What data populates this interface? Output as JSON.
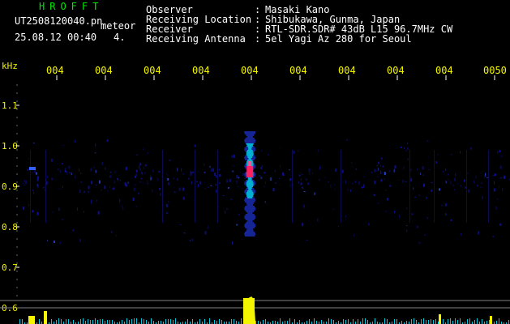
{
  "header": {
    "brand": "HROFFT",
    "filename": "UT2508120040.pn",
    "event_type": "meteor",
    "datetime": "25.08.12 00:40",
    "count": "4.",
    "fields": [
      {
        "label": "Observer",
        "value": "Masaki Kano"
      },
      {
        "label": "Receiving Location",
        "value": "Shibukawa, Gunma, Japan"
      },
      {
        "label": "Receiver",
        "value": "RTL-SDR.SDR# 43dB L15 96.7MHz CW"
      },
      {
        "label": "Receiving Antenna",
        "value": "5el Yagi Az 280 for Seoul"
      }
    ],
    "separator": ":"
  },
  "axis": {
    "unit": "kHz",
    "y_ticks": [
      "1.1",
      "1.0",
      "0.9",
      "0.8",
      "0.7",
      "0.6"
    ],
    "x_ticks": [
      "004",
      "004",
      "004",
      "004",
      "004",
      "004",
      "004",
      "004",
      "004",
      "0050"
    ]
  },
  "colors": {
    "background": "#000000",
    "text_header": "#ffffff",
    "text_brand": "#00e800",
    "text_axis": "#f5f500",
    "tick_marks": "#ffffff",
    "signal_low": "#1010a0",
    "signal_mid": "#00b0d0",
    "signal_high": "#ff2060",
    "level_bar": "#f5f500",
    "level_line": "#00c8e0"
  },
  "spectrogram": {
    "meteor_center_time": 0.49,
    "meteor_peak_freq_khz": 0.93,
    "meteor_freq_span_khz": [
      0.8,
      1.0
    ],
    "carrier_freq_khz": 0.94
  }
}
